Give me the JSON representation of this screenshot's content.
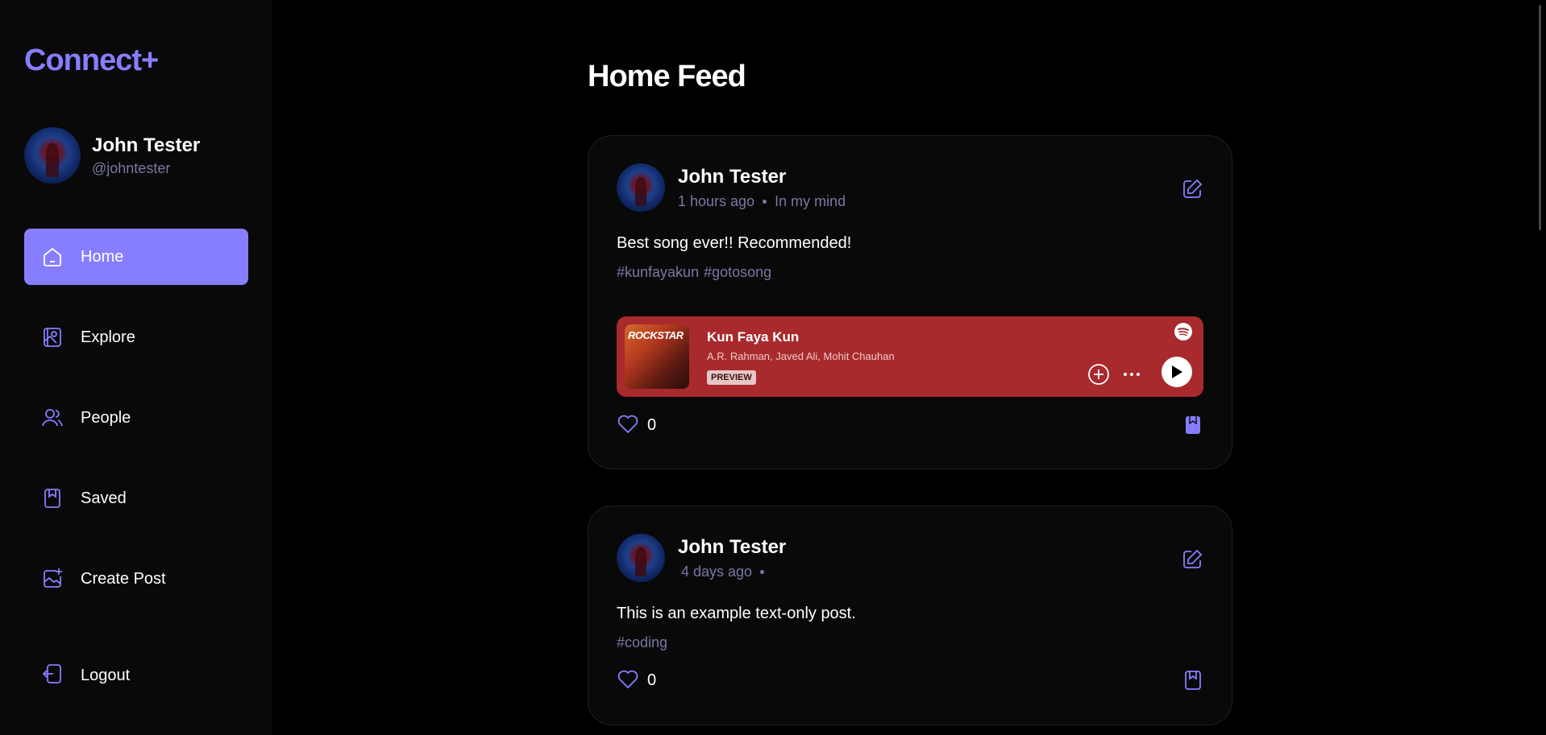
{
  "app": {
    "logo": "Connect+"
  },
  "profile": {
    "name": "John Tester",
    "handle": "@johntester"
  },
  "nav": {
    "items": [
      {
        "label": "Home",
        "icon": "home-icon",
        "active": true
      },
      {
        "label": "Explore",
        "icon": "explore-icon",
        "active": false
      },
      {
        "label": "People",
        "icon": "people-icon",
        "active": false
      },
      {
        "label": "Saved",
        "icon": "bookmark-icon",
        "active": false
      },
      {
        "label": "Create Post",
        "icon": "create-post-icon",
        "active": false
      }
    ],
    "logout_label": "Logout"
  },
  "main": {
    "title": "Home Feed"
  },
  "posts": [
    {
      "author": "John Tester",
      "time": "1 hours ago",
      "location": "In my mind",
      "caption": "Best song ever!! Recommended!",
      "tags": [
        "#kunfayakun",
        "#gotosong"
      ],
      "likes": "0",
      "saved": true,
      "embed": {
        "album_text": "ROCKSTAR",
        "track": "Kun Faya Kun",
        "artists": "A.R. Rahman, Javed Ali, Mohit Chauhan",
        "badge": "PREVIEW",
        "bg_color": "#a82a2d"
      }
    },
    {
      "author": "John Tester",
      "time": "4 days ago",
      "location": "",
      "caption": "This is an example text-only post.",
      "tags": [
        "#coding"
      ],
      "likes": "0",
      "saved": false
    }
  ],
  "colors": {
    "accent": "#877eff",
    "muted": "#7878a3",
    "sidebar_bg": "#09090a",
    "page_bg": "#000000"
  }
}
